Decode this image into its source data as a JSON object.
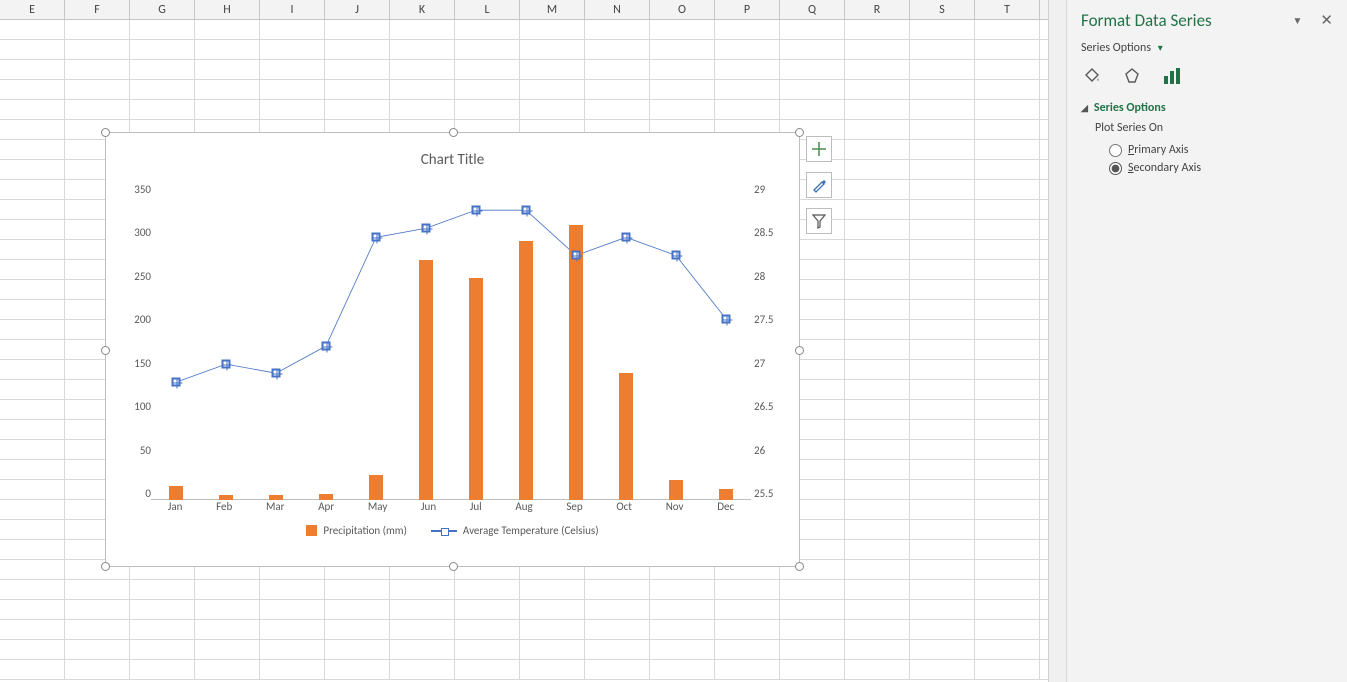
{
  "columns": [
    "E",
    "F",
    "G",
    "H",
    "I",
    "J",
    "K",
    "L",
    "M",
    "N",
    "O",
    "P",
    "Q",
    "R",
    "S",
    "T"
  ],
  "chart": {
    "title": "Chart Title",
    "legend": {
      "series1": "Precipitation (mm)",
      "series2": "Average Temperature (Celsius)"
    }
  },
  "chart_data": {
    "type": "combo",
    "categories": [
      "Jan",
      "Feb",
      "Mar",
      "Apr",
      "May",
      "Jun",
      "Jul",
      "Aug",
      "Sep",
      "Oct",
      "Nov",
      "Dec"
    ],
    "y_left": {
      "min": 0,
      "max": 350,
      "step": 50,
      "ticks": [
        "350",
        "300",
        "250",
        "200",
        "150",
        "100",
        "50",
        "0"
      ]
    },
    "y_right": {
      "min": 25.5,
      "max": 29,
      "step": 0.5,
      "ticks": [
        "29",
        "28.5",
        "28",
        "27.5",
        "27",
        "26.5",
        "26",
        "25.5"
      ]
    },
    "series": [
      {
        "name": "Precipitation (mm)",
        "type": "bar",
        "axis": "left",
        "values": [
          15,
          5,
          5,
          7,
          28,
          265,
          245,
          286,
          304,
          140,
          22,
          12
        ]
      },
      {
        "name": "Average Temperature (Celsius)",
        "type": "line",
        "axis": "right",
        "values": [
          26.8,
          27.0,
          26.9,
          27.2,
          28.4,
          28.5,
          28.7,
          28.7,
          28.2,
          28.4,
          28.2,
          27.5
        ]
      }
    ]
  },
  "chart_tools": {
    "add_element": "+",
    "styles": "brush",
    "filter": "funnel"
  },
  "panel": {
    "title": "Format Data Series",
    "dropdown": "Series Options",
    "section": "Series Options",
    "plot_on_label": "Plot Series On",
    "primary": "Primary Axis",
    "secondary": "Secondary Axis",
    "selected_axis": "secondary",
    "tabs": {
      "fill": "fill",
      "effects": "effects",
      "series": "series"
    }
  }
}
